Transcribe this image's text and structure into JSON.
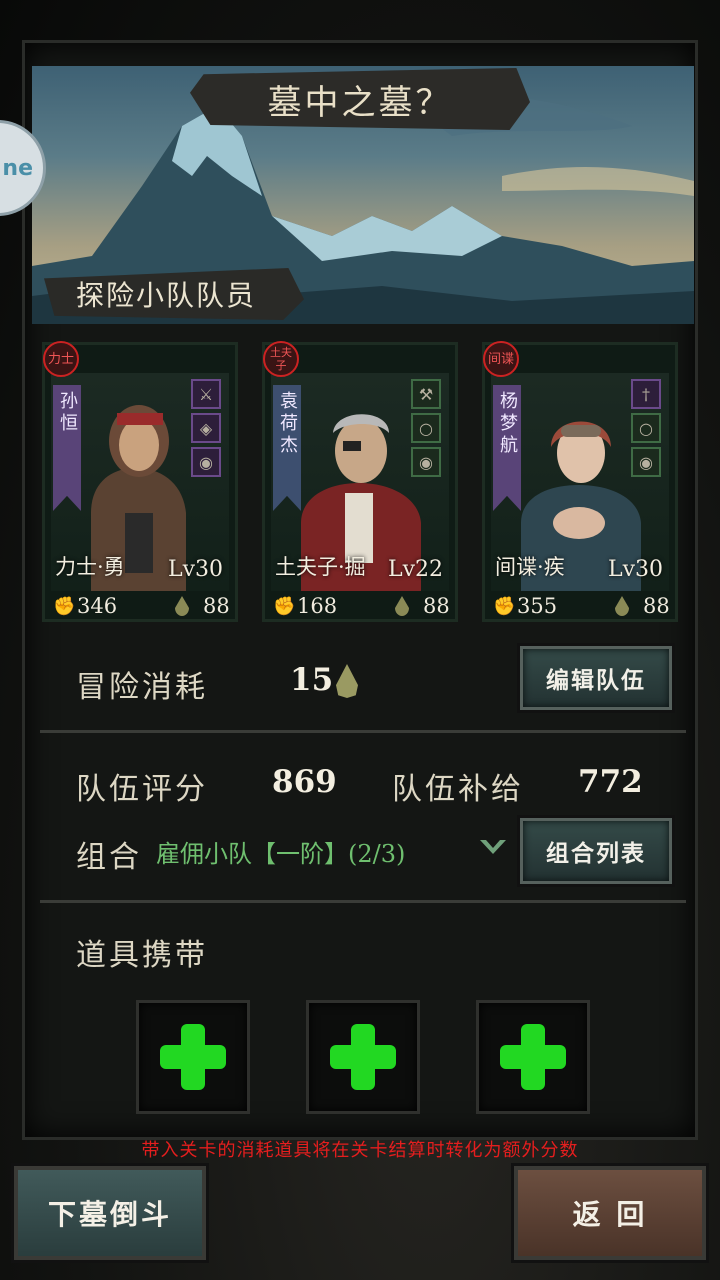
{
  "stage": {
    "title": "墓中之墓？"
  },
  "side_tab": {
    "label": "ne"
  },
  "team_section": {
    "label": "探险小队队员"
  },
  "members": [
    {
      "class_badge": "力士",
      "name": "孙恒",
      "title": "力士·勇",
      "level": "Lv30",
      "power": "346",
      "supply": "88"
    },
    {
      "class_badge": "土夫子",
      "name": "袁荷杰",
      "title": "土夫子·掘",
      "level": "Lv22",
      "power": "168",
      "supply": "88"
    },
    {
      "class_badge": "间谍",
      "name": "杨梦航",
      "title": "间谍·疾",
      "level": "Lv30",
      "power": "355",
      "supply": "88"
    }
  ],
  "adventure": {
    "label": "冒险消耗",
    "value": "15"
  },
  "edit_team_button": "编辑队伍",
  "score": {
    "label": "队伍评分",
    "value": "869"
  },
  "supply": {
    "label": "队伍补给",
    "value": "772"
  },
  "combo": {
    "label": "组合",
    "detail": "雇佣小队【一阶】(2/3)"
  },
  "combo_list_button": "组合列表",
  "items": {
    "label": "道具携带"
  },
  "warning": "带入关卡的消耗道具将在关卡结算时转化为额外分数",
  "descend_button": "下墓倒斗",
  "back_button": "返 回",
  "colors": {
    "accent_green": "#22d822",
    "warning_red": "#e51e1e",
    "combo_green": "#6fbf6f"
  }
}
